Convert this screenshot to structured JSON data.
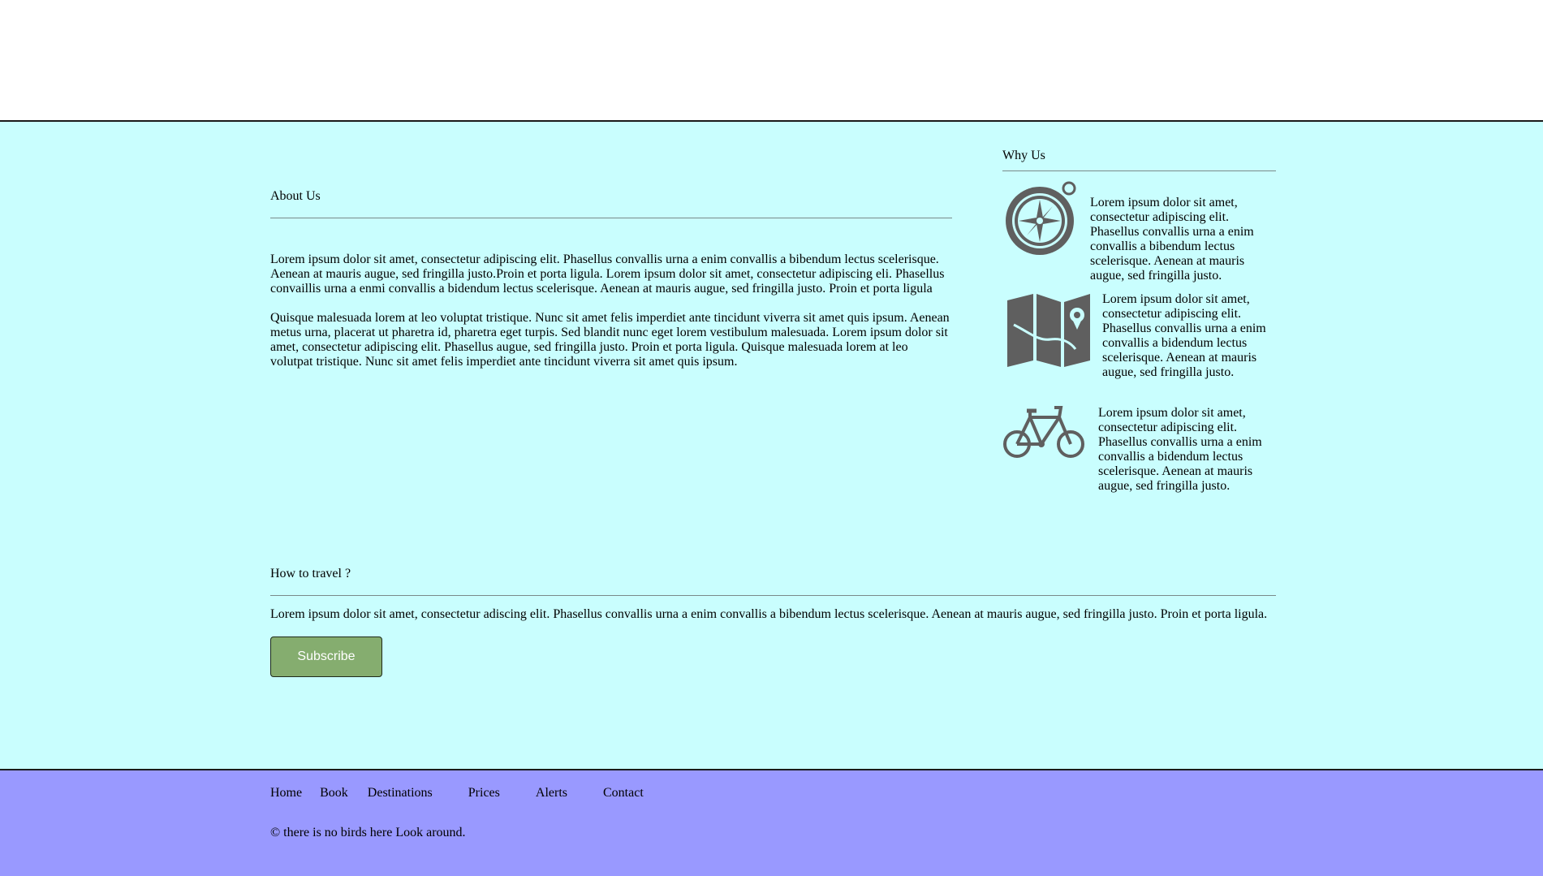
{
  "about": {
    "title": "About Us",
    "paragraph1": "Lorem ipsum dolor sit amet, consectetur adipiscing elit. Phasellus convallis urna a enim convallis a bibendum lectus scelerisque. Aenean at mauris augue, sed fringilla justo.Proin et porta ligula. Lorem ipsum dolor sit amet, consectetur adipiscing eli. Phasellus convaillis urna a enmi convallis a bidendum lectus scelerisque. Aenean at mauris augue, sed fringilla justo. Proin et porta ligula",
    "paragraph2": "Quisque malesuada lorem at leo voluptat tristique. Nunc sit amet felis imperdiet ante tincidunt viverra sit amet quis ipsum. Aenean metus urna, placerat ut pharetra id, pharetra eget turpis. Sed blandit nunc eget lorem vestibulum malesuada. Lorem ipsum dolor sit amet, consectetur adipiscing elit. Phasellus augue, sed fringilla justo. Proin et porta ligula. Quisque malesuada lorem at leo volutpat tristique. Nunc sit amet felis imperdiet ante tincidunt viverra sit amet quis ipsum."
  },
  "why": {
    "title": "Why Us",
    "items": [
      {
        "icon": "compass-icon",
        "text": "Lorem ipsum dolor sit amet, consectetur adipiscing elit. Phasellus convallis urna a enim convallis a bibendum lectus scelerisque. Aenean at mauris augue, sed fringilla justo."
      },
      {
        "icon": "map-icon",
        "text": "Lorem ipsum dolor sit amet, consectetur adipiscing elit. Phasellus convallis urna a enim convallis a bidendum lectus scelerisque. Aenean at mauris augue, sed fringilla justo."
      },
      {
        "icon": "bicycle-icon",
        "text": "Lorem ipsum dolor sit amet, consectetur adipiscing elit. Phasellus convallis urna a enim convallis a bidendum lectus scelerisque. Aenean at mauris augue, sed fringilla justo."
      }
    ]
  },
  "howto": {
    "title": "How to travel ?",
    "text": "Lorem ipsum dolor sit amet, consectetur adiscing elit. Phasellus convallis urna a enim convallis a bibendum lectus scelerisque. Aenean at mauris augue, sed fringilla justo. Proin et porta ligula.",
    "subscribe_label": "Subscribe"
  },
  "footer": {
    "nav": [
      "Home",
      "Book",
      "Destinations",
      "Prices",
      "Alerts",
      "Contact"
    ],
    "copyright": "© there is no birds here Look around."
  },
  "colors": {
    "main_bg": "#c9fefe",
    "footer_bg": "#9999ff",
    "button_bg": "#85ad6f",
    "icon_color": "#5f5f5f"
  }
}
